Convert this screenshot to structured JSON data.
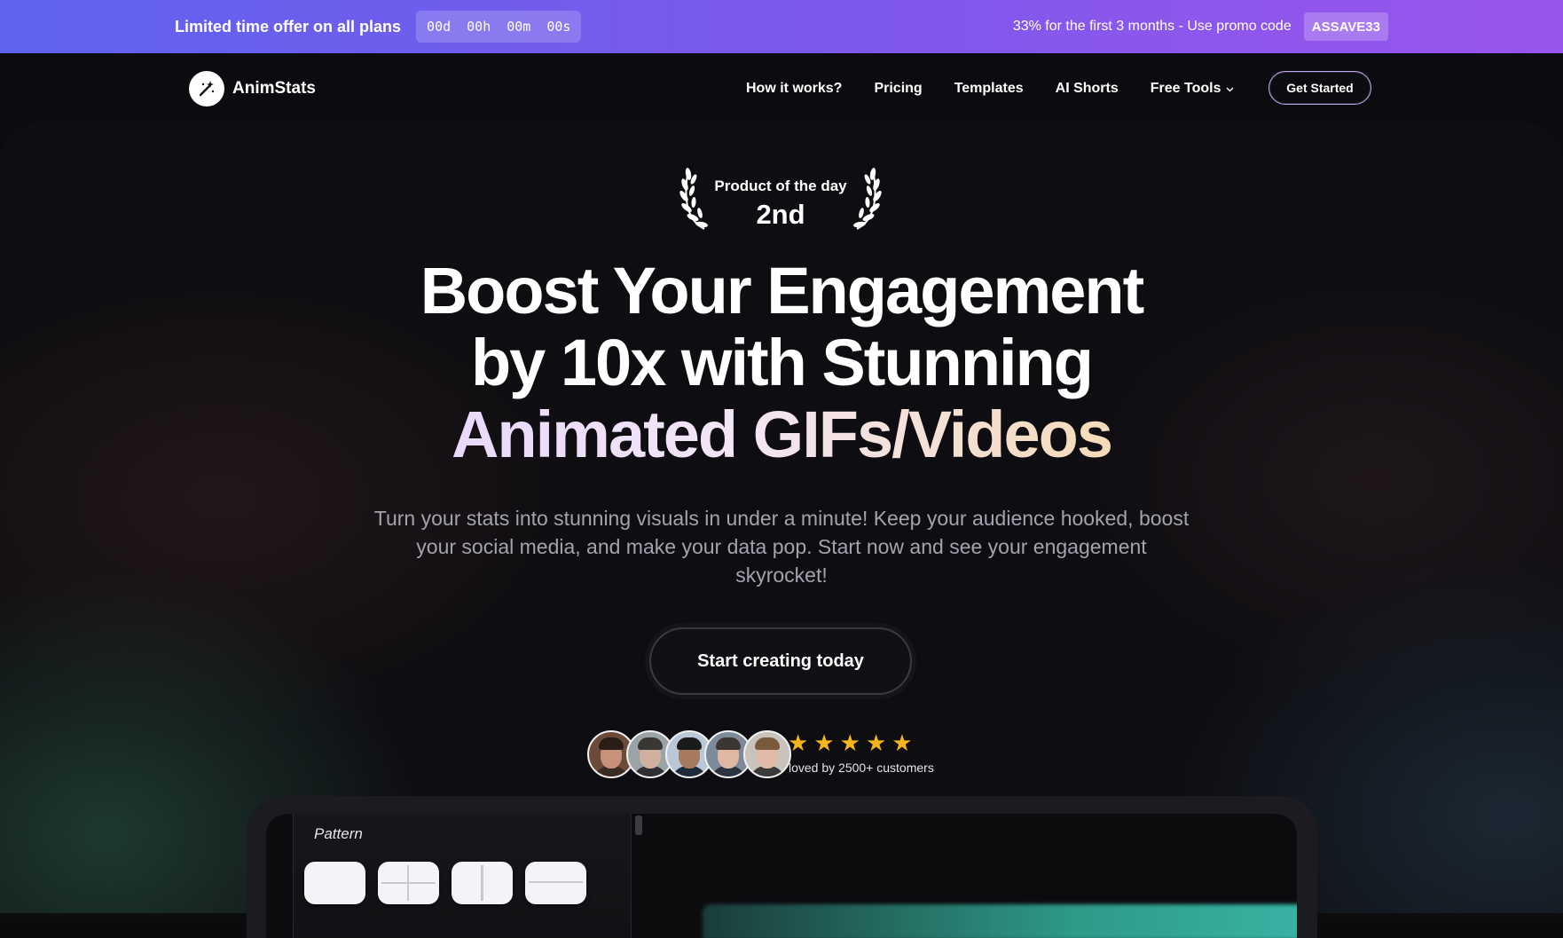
{
  "promo": {
    "title": "Limited time offer on all plans",
    "countdown": {
      "days": "00d",
      "hours": "00h",
      "minutes": "00m",
      "seconds": "00s"
    },
    "text": "33% for the first 3 months - Use promo code",
    "code": "ASSAVE33"
  },
  "nav": {
    "brand": "AnimStats",
    "links": [
      "How it works?",
      "Pricing",
      "Templates",
      "AI Shorts",
      "Free Tools"
    ],
    "cta": "Get Started"
  },
  "badge": {
    "label": "Product of the day",
    "rank": "2nd"
  },
  "hero": {
    "headline_1": "Boost Your Engagement",
    "headline_2": "by 10x with Stunning",
    "headline_3": "Animated GIFs/Videos",
    "subtext": "Turn your stats into stunning visuals in under a minute! Keep your audience hooked, boost your social media, and make your data pop. Start now and see your engagement skyrocket!",
    "cta": "Start creating today"
  },
  "social_proof": {
    "rating": 5,
    "text": "loved by 2500+ customers"
  },
  "preview": {
    "panel_label": "Pattern"
  },
  "colors": {
    "accent_star": "#f5b51c",
    "promo_start": "#5f63ee",
    "promo_end": "#9a55ec"
  }
}
